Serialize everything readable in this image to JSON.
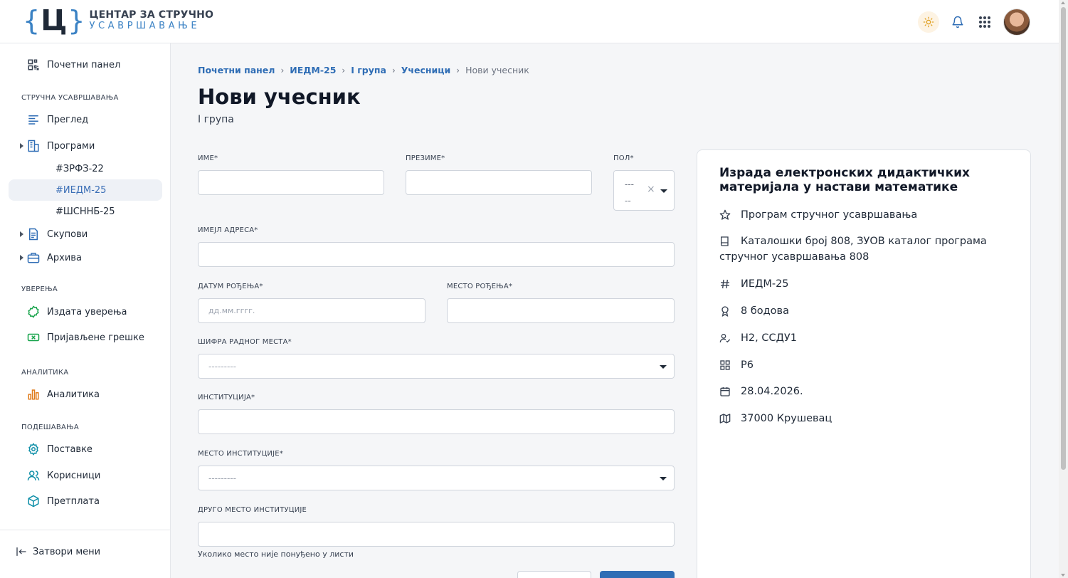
{
  "header": {
    "logo_letter": "Ц",
    "logo_brace_left": "{",
    "logo_brace_right": "}",
    "logo_line1": "ЦЕНТАР ЗА СТРУЧНО",
    "logo_line2": "УСАВРШАВАЊЕ",
    "icons": [
      "sun-icon",
      "bell-icon",
      "apps-grid-icon",
      "avatar"
    ]
  },
  "sidebar": {
    "dashboard": "Почетни панел",
    "section_programs": "СТРУЧНА УСАВРШАВАЊА",
    "overview": "Преглед",
    "programs": "Програми",
    "program_items": [
      "#ЗРФЗ-22",
      "#ИЕДМ-25",
      "#ШСННБ-25"
    ],
    "gatherings": "Скупови",
    "archive": "Архива",
    "section_certificates": "УВЕРЕЊА",
    "issued_certificates": "Издата уверења",
    "reported_errors": "Пријављене грешке",
    "section_analytics": "АНАЛИТИКА",
    "analytics": "Аналитика",
    "section_settings": "ПОДЕШАВАЊА",
    "settings": "Поставке",
    "users": "Корисници",
    "subscription": "Претплата",
    "close_menu": "Затвори мени"
  },
  "breadcrumb": [
    "Почетни панел",
    "ИЕДМ-25",
    "I група",
    "Учесници",
    "Нови учесник"
  ],
  "page": {
    "title": "Нови учесник",
    "subtitle": "I група"
  },
  "form": {
    "first_name_label": "ИМЕ*",
    "last_name_label": "ПРЕЗИМЕ*",
    "gender_label": "ПОЛ*",
    "gender_value_top": "---",
    "gender_value_bottom": "--",
    "gender_clear": "×",
    "email_label": "ИМЕЈЛ АДРЕСА*",
    "birth_date_label": "ДАТУМ РОЂЕЊА*",
    "birth_date_placeholder": "дд.мм.гггг.",
    "birth_place_label": "МЕСТО РОЂЕЊА*",
    "job_code_label": "ШИФРА РАДНОГ МЕСТА*",
    "job_code_value": "---------",
    "institution_label": "ИНСТИТУЦИЈА*",
    "institution_place_label": "МЕСТО ИНСТИТУЦИЈЕ*",
    "institution_place_value": "---------",
    "other_place_label": "ДРУГО МЕСТО ИНСТИТУЦИЈЕ",
    "other_place_help": "Уколико место није понуђено у листи"
  },
  "card": {
    "title": "Израда електронских дидактичких материјала у настави математике",
    "rows": [
      {
        "icon": "star-icon",
        "text": "Програм стручног усавршавања"
      },
      {
        "icon": "book-icon",
        "text": "Каталошки број 808, ЗУОВ каталог програма стручног усавршавања 808"
      },
      {
        "icon": "hash-icon",
        "text": "ИЕДМ-25"
      },
      {
        "icon": "award-icon",
        "text": "8 бодова"
      },
      {
        "icon": "user-check-icon",
        "text": "Н2, ССДУ1"
      },
      {
        "icon": "grid-icon",
        "text": "Р6"
      },
      {
        "icon": "calendar-icon",
        "text": "28.04.2026."
      },
      {
        "icon": "map-icon",
        "text": "37000 Крушевац"
      }
    ]
  },
  "colors": {
    "accent": "#2f6db5",
    "logo_blue": "#3b82c4",
    "active_bg": "#eef1f6",
    "primary_button": "#2f6db5"
  }
}
